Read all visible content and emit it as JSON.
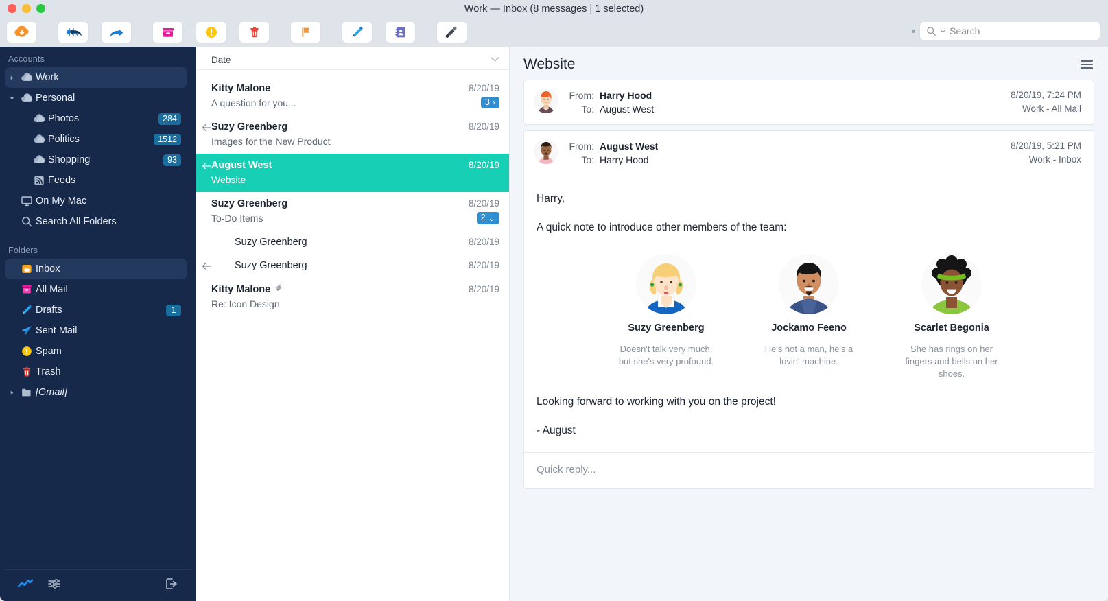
{
  "window": {
    "title": "Work — Inbox (8 messages | 1 selected)"
  },
  "toolbar": {
    "buttons": [
      {
        "name": "get-mail-button",
        "icon": "cloud-download-icon",
        "label": "Get Mail"
      },
      {
        "name": "reply-all-button",
        "icon": "reply-all-icon",
        "label": "Reply All"
      },
      {
        "name": "forward-button",
        "icon": "forward-arrow-icon",
        "label": "Forward"
      },
      {
        "name": "archive-button",
        "icon": "archive-box-icon",
        "label": "Archive"
      },
      {
        "name": "junk-button",
        "icon": "exclamation-circle-icon",
        "label": "Junk"
      },
      {
        "name": "delete-button",
        "icon": "trash-icon",
        "label": "Delete"
      },
      {
        "name": "flag-button",
        "icon": "flag-icon",
        "label": "Flag"
      },
      {
        "name": "compose-button",
        "icon": "pencil-icon",
        "label": "Compose"
      },
      {
        "name": "contacts-button",
        "icon": "address-book-icon",
        "label": "Contacts"
      },
      {
        "name": "cleanup-button",
        "icon": "paintbrush-icon",
        "label": "Cleanup"
      }
    ],
    "search": {
      "placeholder": "Search",
      "value": ""
    }
  },
  "sidebar": {
    "accounts_header": "Accounts",
    "accounts": [
      {
        "label": "Work",
        "icon": "cloud-icon",
        "twisty": "right",
        "selected": true,
        "badge": "",
        "indent": 0
      },
      {
        "label": "Personal",
        "icon": "cloud-icon",
        "twisty": "down",
        "selected": false,
        "badge": "",
        "indent": 0
      },
      {
        "label": "Photos",
        "icon": "cloud-icon",
        "twisty": "",
        "selected": false,
        "badge": "284",
        "indent": 1
      },
      {
        "label": "Politics",
        "icon": "cloud-icon",
        "twisty": "",
        "selected": false,
        "badge": "1512",
        "indent": 1
      },
      {
        "label": "Shopping",
        "icon": "cloud-icon",
        "twisty": "",
        "selected": false,
        "badge": "93",
        "indent": 1
      },
      {
        "label": "Feeds",
        "icon": "rss-icon",
        "twisty": "",
        "selected": false,
        "badge": "",
        "indent": 1
      },
      {
        "label": "On My Mac",
        "icon": "display-icon",
        "twisty": "",
        "selected": false,
        "badge": "",
        "indent": 0
      },
      {
        "label": "Search All Folders",
        "icon": "search-icon",
        "twisty": "",
        "selected": false,
        "badge": "",
        "indent": 0
      }
    ],
    "folders_header": "Folders",
    "folders": [
      {
        "label": "Inbox",
        "icon": "inbox-icon",
        "twisty": "",
        "selected": true,
        "badge": "",
        "italic": false
      },
      {
        "label": "All Mail",
        "icon": "all-mail-icon",
        "twisty": "",
        "selected": false,
        "badge": "",
        "italic": false
      },
      {
        "label": "Drafts",
        "icon": "drafts-pencil-icon",
        "twisty": "",
        "selected": false,
        "badge": "1",
        "italic": false
      },
      {
        "label": "Sent Mail",
        "icon": "sent-paperplane-icon",
        "twisty": "",
        "selected": false,
        "badge": "",
        "italic": false
      },
      {
        "label": "Spam",
        "icon": "spam-exclamation-icon",
        "twisty": "",
        "selected": false,
        "badge": "",
        "italic": false
      },
      {
        "label": "Trash",
        "icon": "trash-icon",
        "twisty": "",
        "selected": false,
        "badge": "",
        "italic": false
      },
      {
        "label": "[Gmail]",
        "icon": "folder-icon",
        "twisty": "right",
        "selected": false,
        "badge": "",
        "italic": true
      }
    ],
    "bottom": [
      {
        "name": "activity-icon",
        "label": "Activity"
      },
      {
        "name": "filter-sliders-icon",
        "label": "Filters"
      },
      {
        "name": "logout-icon",
        "label": "Log Out"
      }
    ]
  },
  "message_list": {
    "sort_label": "Date",
    "sort_chevron": "chevron-down-icon",
    "rows": [
      {
        "sender": "Kitty Malone",
        "subject": "A question for you...",
        "date": "8/20/19",
        "replied": false,
        "attachment": false,
        "selected": false,
        "count_badge": "3",
        "count_chevron": "›",
        "sub": false,
        "bold": true
      },
      {
        "sender": "Suzy Greenberg",
        "subject": "Images for the New Product",
        "date": "8/20/19",
        "replied": true,
        "attachment": false,
        "selected": false,
        "count_badge": "",
        "count_chevron": "",
        "sub": false,
        "bold": true
      },
      {
        "sender": "August West",
        "subject": "Website",
        "date": "8/20/19",
        "replied": true,
        "attachment": false,
        "selected": true,
        "count_badge": "",
        "count_chevron": "",
        "sub": false,
        "bold": true
      },
      {
        "sender": "Suzy Greenberg",
        "subject": "To-Do Items",
        "date": "8/20/19",
        "replied": false,
        "attachment": false,
        "selected": false,
        "count_badge": "2",
        "count_chevron": "⌄",
        "sub": false,
        "bold": true
      },
      {
        "sender": "Suzy Greenberg",
        "subject": "",
        "date": "8/20/19",
        "replied": false,
        "attachment": false,
        "selected": false,
        "count_badge": "",
        "count_chevron": "",
        "sub": true,
        "bold": false
      },
      {
        "sender": "Suzy Greenberg",
        "subject": "",
        "date": "8/20/19",
        "replied": true,
        "attachment": false,
        "selected": false,
        "count_badge": "",
        "count_chevron": "",
        "sub": true,
        "bold": false
      },
      {
        "sender": "Kitty Malone",
        "subject": "Re: Icon Design",
        "date": "8/20/19",
        "replied": false,
        "attachment": true,
        "selected": false,
        "count_badge": "",
        "count_chevron": "",
        "sub": false,
        "bold": true
      }
    ]
  },
  "reader": {
    "subject": "Website",
    "menu_icon": "hamburger-menu-icon",
    "messages": [
      {
        "from_label": "From:",
        "from": "Harry Hood",
        "to_label": "To:",
        "to": "August West",
        "timestamp": "8/20/19, 7:24 PM",
        "mailbox": "Work - All Mail",
        "avatar": "harry-hood-avatar",
        "expanded": false
      },
      {
        "from_label": "From:",
        "from": "August West",
        "to_label": "To:",
        "to": "Harry Hood",
        "timestamp": "8/20/19, 5:21 PM",
        "mailbox": "Work - Inbox",
        "avatar": "august-west-avatar",
        "expanded": true
      }
    ],
    "body": {
      "greeting": "Harry,",
      "intro": "A quick note to introduce other members of the team:",
      "closing": "Looking forward to working with you on the project!",
      "signature": "- August",
      "team": [
        {
          "name": "Suzy Greenberg",
          "desc": "Doesn't talk very much, but she's very profound.",
          "avatar": "suzy-greenberg-avatar"
        },
        {
          "name": "Jockamo Feeno",
          "desc": "He's not a man, he's a lovin' machine.",
          "avatar": "jockamo-feeno-avatar"
        },
        {
          "name": "Scarlet Begonia",
          "desc": "She has rings on her fingers and bells on her shoes.",
          "avatar": "scarlet-begonia-avatar"
        }
      ]
    },
    "quick_reply_placeholder": "Quick reply..."
  },
  "colors": {
    "selection_teal": "#17cfb4",
    "sidebar_navy": "#16294b",
    "badge_blue": "#1a6e9e",
    "count_badge_blue": "#2f8fd0"
  }
}
